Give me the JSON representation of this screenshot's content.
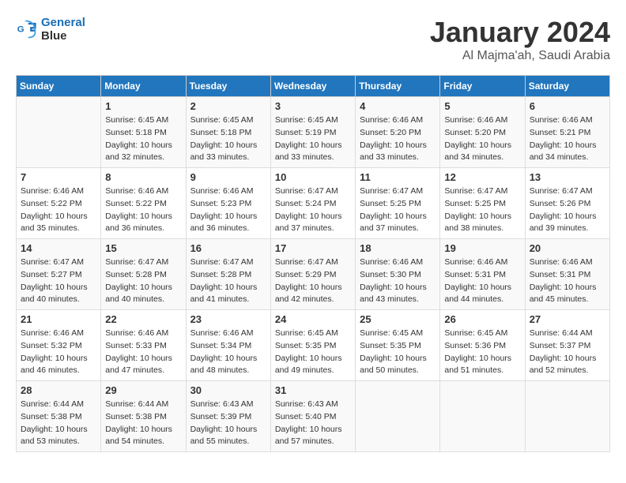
{
  "header": {
    "logo_line1": "General",
    "logo_line2": "Blue",
    "month": "January 2024",
    "location": "Al Majma'ah, Saudi Arabia"
  },
  "weekdays": [
    "Sunday",
    "Monday",
    "Tuesday",
    "Wednesday",
    "Thursday",
    "Friday",
    "Saturday"
  ],
  "weeks": [
    [
      {
        "day": "",
        "info": ""
      },
      {
        "day": "1",
        "info": "Sunrise: 6:45 AM\nSunset: 5:18 PM\nDaylight: 10 hours\nand 32 minutes."
      },
      {
        "day": "2",
        "info": "Sunrise: 6:45 AM\nSunset: 5:18 PM\nDaylight: 10 hours\nand 33 minutes."
      },
      {
        "day": "3",
        "info": "Sunrise: 6:45 AM\nSunset: 5:19 PM\nDaylight: 10 hours\nand 33 minutes."
      },
      {
        "day": "4",
        "info": "Sunrise: 6:46 AM\nSunset: 5:20 PM\nDaylight: 10 hours\nand 33 minutes."
      },
      {
        "day": "5",
        "info": "Sunrise: 6:46 AM\nSunset: 5:20 PM\nDaylight: 10 hours\nand 34 minutes."
      },
      {
        "day": "6",
        "info": "Sunrise: 6:46 AM\nSunset: 5:21 PM\nDaylight: 10 hours\nand 34 minutes."
      }
    ],
    [
      {
        "day": "7",
        "info": "Sunrise: 6:46 AM\nSunset: 5:22 PM\nDaylight: 10 hours\nand 35 minutes."
      },
      {
        "day": "8",
        "info": "Sunrise: 6:46 AM\nSunset: 5:22 PM\nDaylight: 10 hours\nand 36 minutes."
      },
      {
        "day": "9",
        "info": "Sunrise: 6:46 AM\nSunset: 5:23 PM\nDaylight: 10 hours\nand 36 minutes."
      },
      {
        "day": "10",
        "info": "Sunrise: 6:47 AM\nSunset: 5:24 PM\nDaylight: 10 hours\nand 37 minutes."
      },
      {
        "day": "11",
        "info": "Sunrise: 6:47 AM\nSunset: 5:25 PM\nDaylight: 10 hours\nand 37 minutes."
      },
      {
        "day": "12",
        "info": "Sunrise: 6:47 AM\nSunset: 5:25 PM\nDaylight: 10 hours\nand 38 minutes."
      },
      {
        "day": "13",
        "info": "Sunrise: 6:47 AM\nSunset: 5:26 PM\nDaylight: 10 hours\nand 39 minutes."
      }
    ],
    [
      {
        "day": "14",
        "info": "Sunrise: 6:47 AM\nSunset: 5:27 PM\nDaylight: 10 hours\nand 40 minutes."
      },
      {
        "day": "15",
        "info": "Sunrise: 6:47 AM\nSunset: 5:28 PM\nDaylight: 10 hours\nand 40 minutes."
      },
      {
        "day": "16",
        "info": "Sunrise: 6:47 AM\nSunset: 5:28 PM\nDaylight: 10 hours\nand 41 minutes."
      },
      {
        "day": "17",
        "info": "Sunrise: 6:47 AM\nSunset: 5:29 PM\nDaylight: 10 hours\nand 42 minutes."
      },
      {
        "day": "18",
        "info": "Sunrise: 6:46 AM\nSunset: 5:30 PM\nDaylight: 10 hours\nand 43 minutes."
      },
      {
        "day": "19",
        "info": "Sunrise: 6:46 AM\nSunset: 5:31 PM\nDaylight: 10 hours\nand 44 minutes."
      },
      {
        "day": "20",
        "info": "Sunrise: 6:46 AM\nSunset: 5:31 PM\nDaylight: 10 hours\nand 45 minutes."
      }
    ],
    [
      {
        "day": "21",
        "info": "Sunrise: 6:46 AM\nSunset: 5:32 PM\nDaylight: 10 hours\nand 46 minutes."
      },
      {
        "day": "22",
        "info": "Sunrise: 6:46 AM\nSunset: 5:33 PM\nDaylight: 10 hours\nand 47 minutes."
      },
      {
        "day": "23",
        "info": "Sunrise: 6:46 AM\nSunset: 5:34 PM\nDaylight: 10 hours\nand 48 minutes."
      },
      {
        "day": "24",
        "info": "Sunrise: 6:45 AM\nSunset: 5:35 PM\nDaylight: 10 hours\nand 49 minutes."
      },
      {
        "day": "25",
        "info": "Sunrise: 6:45 AM\nSunset: 5:35 PM\nDaylight: 10 hours\nand 50 minutes."
      },
      {
        "day": "26",
        "info": "Sunrise: 6:45 AM\nSunset: 5:36 PM\nDaylight: 10 hours\nand 51 minutes."
      },
      {
        "day": "27",
        "info": "Sunrise: 6:44 AM\nSunset: 5:37 PM\nDaylight: 10 hours\nand 52 minutes."
      }
    ],
    [
      {
        "day": "28",
        "info": "Sunrise: 6:44 AM\nSunset: 5:38 PM\nDaylight: 10 hours\nand 53 minutes."
      },
      {
        "day": "29",
        "info": "Sunrise: 6:44 AM\nSunset: 5:38 PM\nDaylight: 10 hours\nand 54 minutes."
      },
      {
        "day": "30",
        "info": "Sunrise: 6:43 AM\nSunset: 5:39 PM\nDaylight: 10 hours\nand 55 minutes."
      },
      {
        "day": "31",
        "info": "Sunrise: 6:43 AM\nSunset: 5:40 PM\nDaylight: 10 hours\nand 57 minutes."
      },
      {
        "day": "",
        "info": ""
      },
      {
        "day": "",
        "info": ""
      },
      {
        "day": "",
        "info": ""
      }
    ]
  ]
}
